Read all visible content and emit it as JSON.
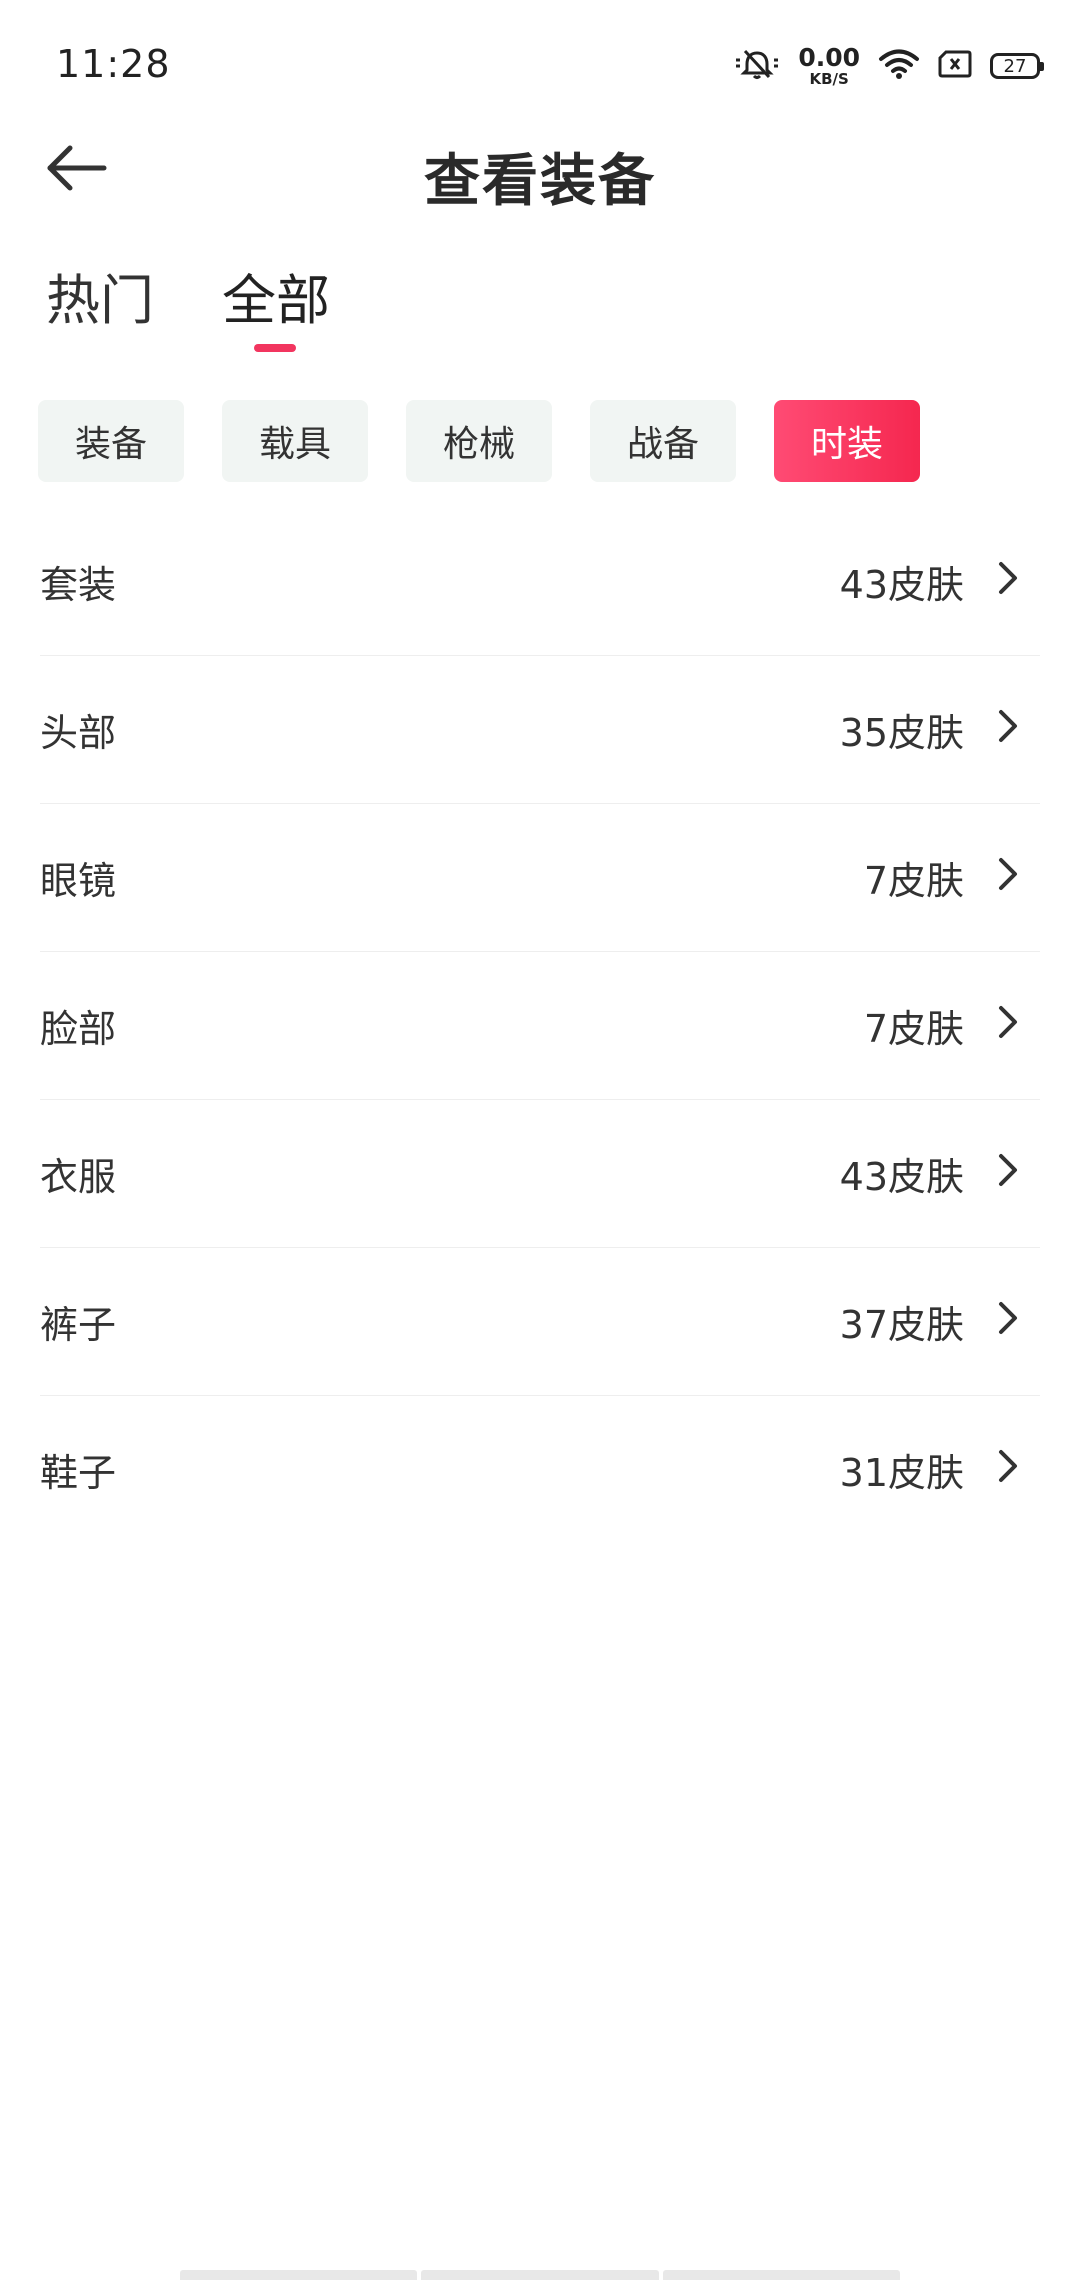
{
  "status_bar": {
    "time": "11:28",
    "net_speed_value": "0.00",
    "net_speed_unit": "KB/S",
    "battery": "27",
    "icons": [
      "mute-icon",
      "wifi-icon",
      "sim-icon",
      "battery-icon"
    ]
  },
  "header": {
    "title": "查看装备",
    "back_icon": "arrow-left-icon"
  },
  "top_tabs": [
    {
      "label": "热门",
      "active": false
    },
    {
      "label": "全部",
      "active": true
    }
  ],
  "chips": [
    {
      "label": "装备",
      "active": false
    },
    {
      "label": "载具",
      "active": false
    },
    {
      "label": "枪械",
      "active": false
    },
    {
      "label": "战备",
      "active": false
    },
    {
      "label": "时装",
      "active": true
    }
  ],
  "list": [
    {
      "label": "套装",
      "count": "43皮肤"
    },
    {
      "label": "头部",
      "count": "35皮肤"
    },
    {
      "label": "眼镜",
      "count": "7皮肤"
    },
    {
      "label": "脸部",
      "count": "7皮肤"
    },
    {
      "label": "衣服",
      "count": "43皮肤"
    },
    {
      "label": "裤子",
      "count": "37皮肤"
    },
    {
      "label": "鞋子",
      "count": "31皮肤"
    }
  ],
  "colors": {
    "accent": "#f2355f",
    "chip_bg": "#f1f5f3",
    "text": "#333333"
  }
}
